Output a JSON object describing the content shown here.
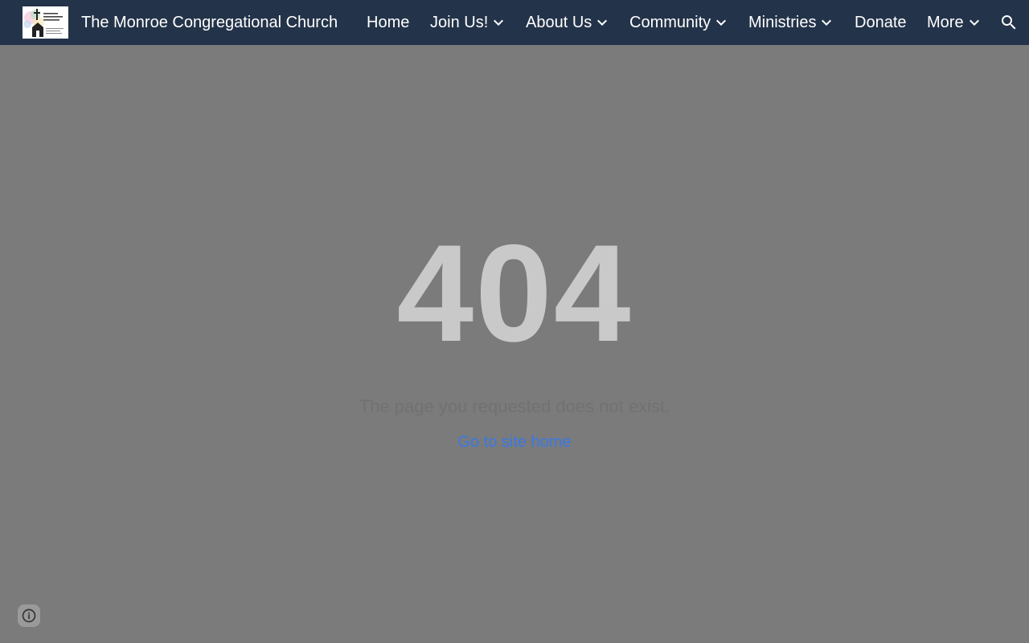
{
  "header": {
    "site_title": "The Monroe Congregational Church",
    "background_color": "#233349",
    "logo": {
      "lines": [
        "Monroe",
        "Congregational",
        "Church, UCC"
      ],
      "icon": "church-logo"
    },
    "nav": {
      "home": "Home",
      "join_us": "Join Us!",
      "about_us": "About Us",
      "community": "Community",
      "ministries": "Ministries",
      "donate": "Donate",
      "more": "More"
    },
    "dropdown_icon": "chevron-down-icon",
    "search_icon": "search-icon"
  },
  "main": {
    "error_code": "404",
    "message": "The page you requested does not exist.",
    "home_link": "Go to site home",
    "link_color": "#3b78e7"
  },
  "footer": {
    "info_icon": "info-icon"
  }
}
